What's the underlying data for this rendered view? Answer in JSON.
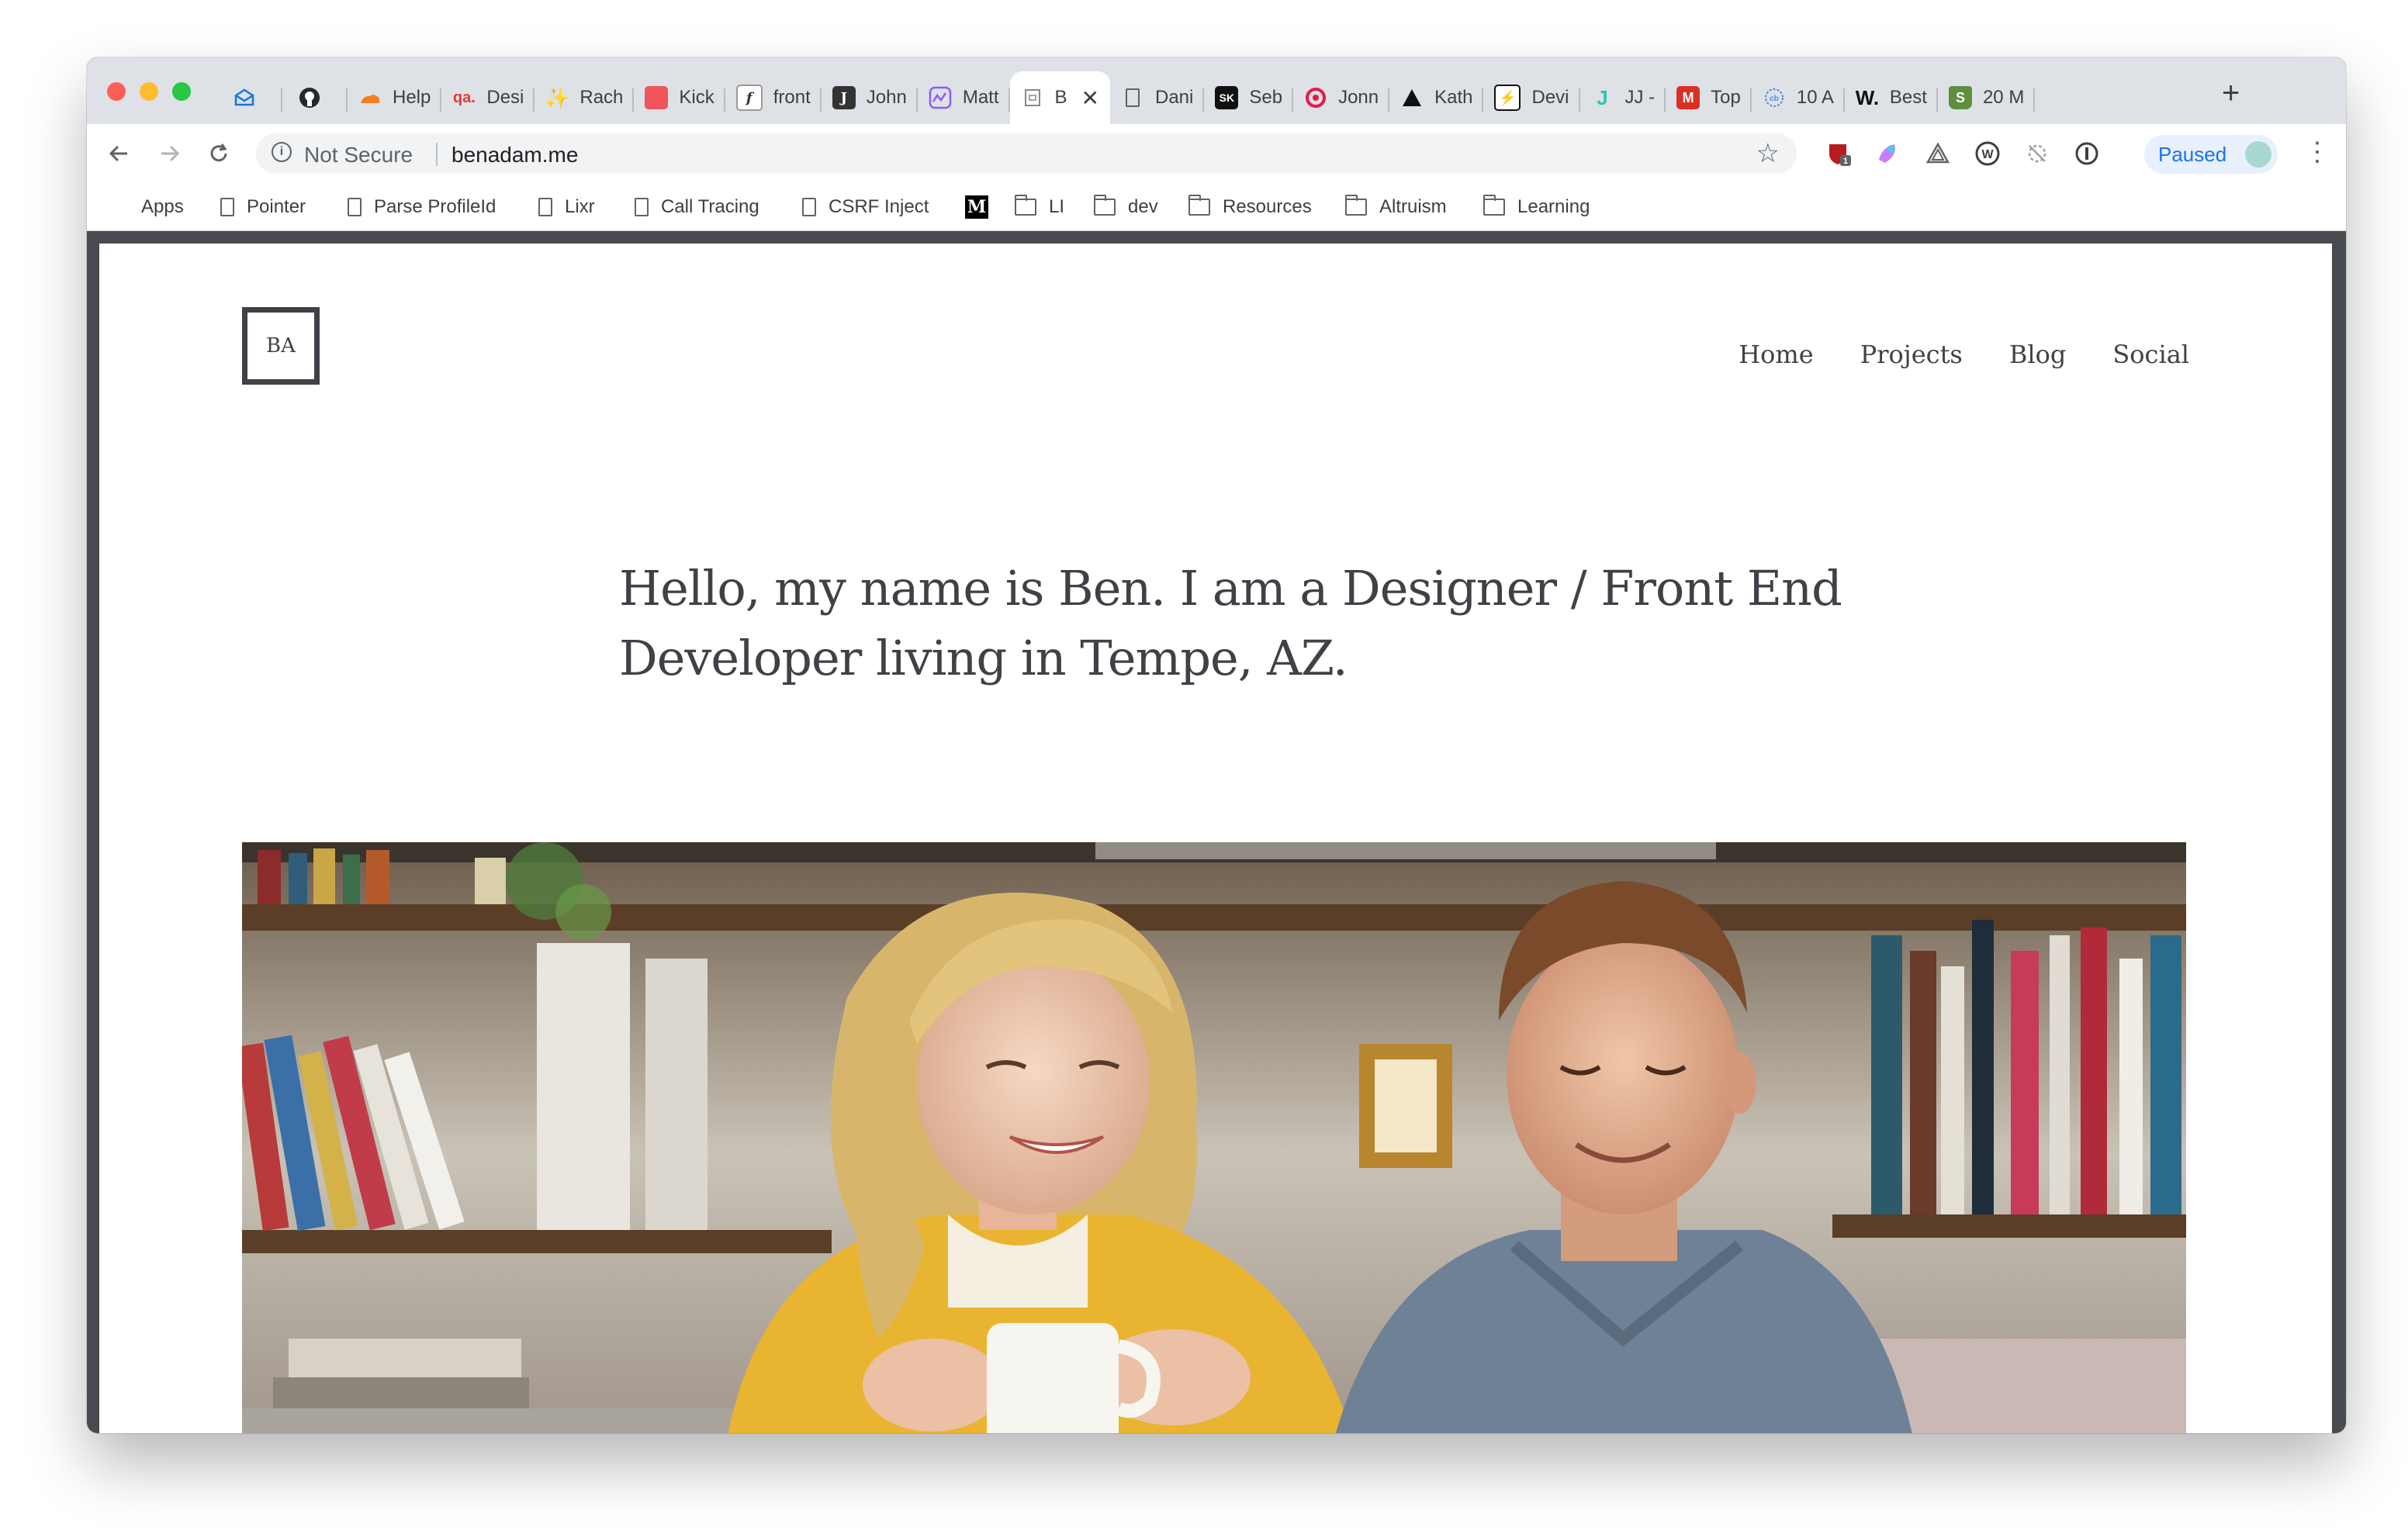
{
  "browser": {
    "tabs": [
      {
        "label": "",
        "icon": "envelope-icon",
        "color": "#1a73e8",
        "pinned": true
      },
      {
        "label": "",
        "icon": "github-icon",
        "color": "#24292e",
        "pinned": true
      },
      {
        "label": "Help",
        "icon": "cloudflare-icon",
        "color": "#f38020"
      },
      {
        "label": "Desi",
        "icon": "qa-icon",
        "color": "#e53935"
      },
      {
        "label": "Rach",
        "icon": "sparkle-icon",
        "color": "#f5c542"
      },
      {
        "label": "Kick",
        "icon": "kickstarter-icon",
        "color": "#f0555b"
      },
      {
        "label": "front",
        "icon": "function-icon",
        "color": "#ffffff"
      },
      {
        "label": "John",
        "icon": "j-icon",
        "color": "#333333"
      },
      {
        "label": "Matt",
        "icon": "chart-icon",
        "color": "#8e5cf6"
      },
      {
        "label": "B",
        "icon": "page-icon",
        "color": "#ffffff",
        "active": true
      },
      {
        "label": "Dani",
        "icon": "page-icon",
        "color": "#ffffff"
      },
      {
        "label": "Seb",
        "icon": "sk-icon",
        "color": "#111111"
      },
      {
        "label": "Jonn",
        "icon": "swirl-icon",
        "color": "#e5194a"
      },
      {
        "label": "Kath",
        "icon": "triangle-icon",
        "color": "#111111"
      },
      {
        "label": "Devi",
        "icon": "bolt-icon",
        "color": "#111111"
      },
      {
        "label": "JJ -",
        "icon": "jj-icon",
        "color": "#2ec4b6"
      },
      {
        "label": "Top",
        "icon": "gmail-icon",
        "color": "#d93025"
      },
      {
        "label": "10 A",
        "icon": "codepen-icon",
        "color": "#4a90e2"
      },
      {
        "label": "Best",
        "icon": "w-icon",
        "color": "#111111"
      },
      {
        "label": "20 M",
        "icon": "shopify-icon",
        "color": "#5e8e3e"
      }
    ],
    "new_tab": "+",
    "close_glyph": "✕",
    "security_label": "Not Secure",
    "url": "benadam.me",
    "profile_status": "Paused",
    "extension_badge": "1",
    "bookmarks": [
      {
        "label": "Apps",
        "icon": "apps-icon"
      },
      {
        "label": "Pointer",
        "icon": "page-icon"
      },
      {
        "label": "Parse ProfileId",
        "icon": "page-icon"
      },
      {
        "label": "Lixr",
        "icon": "page-icon"
      },
      {
        "label": "Call Tracing",
        "icon": "page-icon"
      },
      {
        "label": "CSRF Inject",
        "icon": "page-icon"
      },
      {
        "label": "",
        "icon": "medium-icon"
      },
      {
        "label": "LI",
        "icon": "folder-icon"
      },
      {
        "label": "dev",
        "icon": "folder-icon"
      },
      {
        "label": "Resources",
        "icon": "folder-icon"
      },
      {
        "label": "Altruism",
        "icon": "folder-icon"
      },
      {
        "label": "Learning",
        "icon": "folder-icon"
      }
    ]
  },
  "site": {
    "logo": "BA",
    "nav": [
      "Home",
      "Projects",
      "Blog",
      "Social"
    ],
    "hero_line1": "Hello, my name is Ben. I am a Designer / Front End",
    "hero_line2": "Developer living in Tempe, AZ.",
    "accent_color": "#3e4247"
  }
}
